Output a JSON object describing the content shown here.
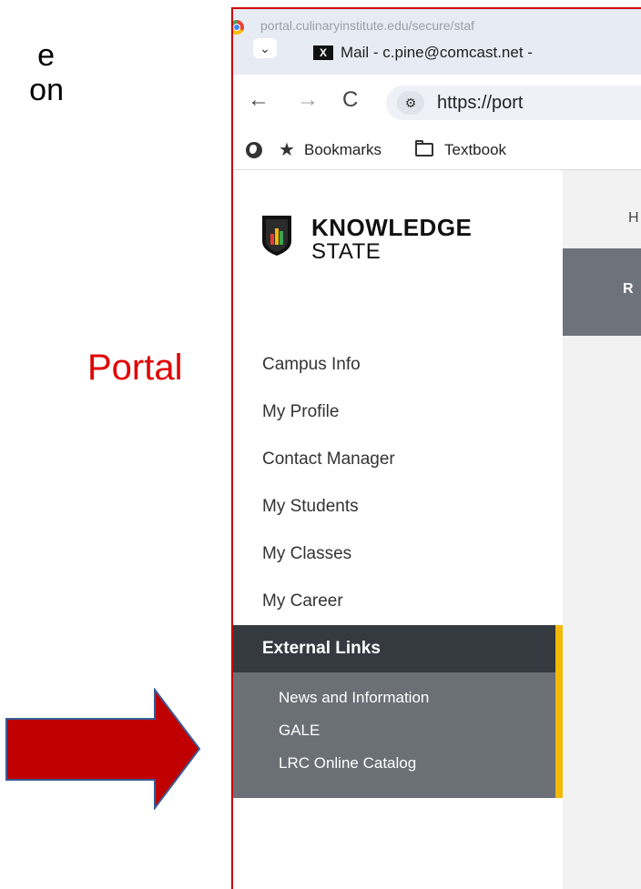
{
  "slide": {
    "fragment_1": "e",
    "fragment_2": "on",
    "portal_label": "Portal",
    "label_color": "#e00000",
    "arrow_color": "#c00000"
  },
  "browser": {
    "page_url": "portal.culinaryinstitute.edu/secure/staf",
    "tab_title": "Mail - c.pine@comcast.net -",
    "omnibox_url": "https://port",
    "bookmarks_label": "Bookmarks",
    "textbook_label": "Textbook"
  },
  "sidebar": {
    "logo_line1": "KNOWLEDGE",
    "logo_line2": "STATE",
    "items": [
      {
        "label": "Campus Info"
      },
      {
        "label": "My Profile"
      },
      {
        "label": "Contact Manager"
      },
      {
        "label": "My Students"
      },
      {
        "label": "My Classes"
      },
      {
        "label": "My Career"
      }
    ],
    "active_item": "External Links",
    "sub_items": [
      {
        "label": "News and Information"
      },
      {
        "label": "GALE"
      },
      {
        "label": "LRC Online Catalog"
      }
    ],
    "accent_color": "#f3b800"
  },
  "content": {
    "breadcrumb_fragment": "H",
    "banner_fragment": "R"
  }
}
